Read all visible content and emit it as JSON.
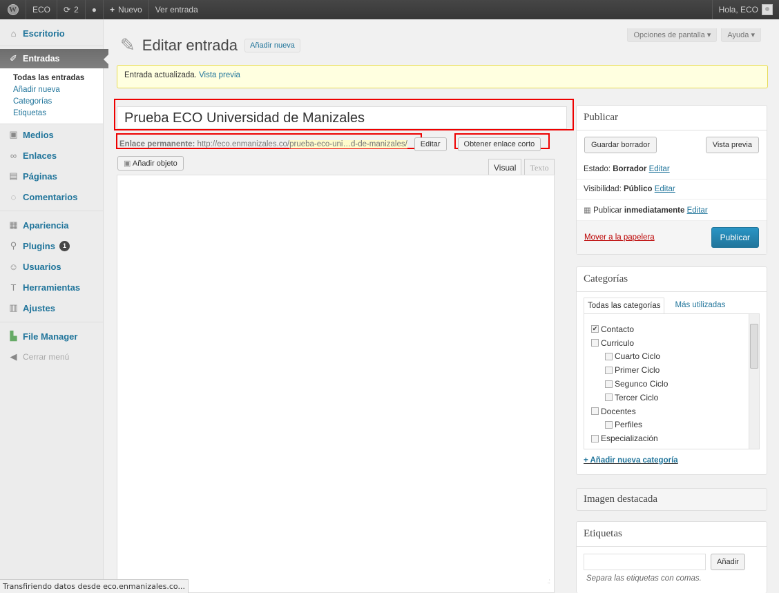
{
  "adminbar": {
    "site_name": "ECO",
    "updates_count": "2",
    "new_label": "Nuevo",
    "view_post": "Ver entrada",
    "greeting": "Hola, ECO"
  },
  "sidebar": {
    "items": [
      {
        "label": "Escritorio",
        "icon": "home-icon"
      },
      {
        "label": "Entradas",
        "icon": "pin-icon"
      },
      {
        "label": "Medios",
        "icon": "media-icon"
      },
      {
        "label": "Enlaces",
        "icon": "link-icon"
      },
      {
        "label": "Páginas",
        "icon": "pages-icon"
      },
      {
        "label": "Comentarios",
        "icon": "comment-icon"
      },
      {
        "label": "Apariencia",
        "icon": "appearance-icon"
      },
      {
        "label": "Plugins",
        "icon": "plugin-icon",
        "badge": "1"
      },
      {
        "label": "Usuarios",
        "icon": "users-icon"
      },
      {
        "label": "Herramientas",
        "icon": "tools-icon"
      },
      {
        "label": "Ajustes",
        "icon": "settings-icon"
      },
      {
        "label": "File Manager",
        "icon": "file-manager-icon"
      }
    ],
    "submenu": [
      "Todas las entradas",
      "Añadir nueva",
      "Categorías",
      "Etiquetas"
    ],
    "collapse_label": "Cerrar menú"
  },
  "header": {
    "screen_options": "Opciones de pantalla",
    "help": "Ayuda",
    "page_title": "Editar entrada",
    "add_new": "Añadir nueva"
  },
  "notice": {
    "text": "Entrada actualizada.",
    "link": "Vista previa"
  },
  "post": {
    "title": "Prueba ECO Universidad de Manizales",
    "permalink_label": "Enlace permanente:",
    "permalink_base": "http://eco.enmanizales.co/",
    "permalink_slug": "prueba-eco-uni…d-de-manizales/",
    "edit_button": "Editar",
    "shortlink_button": "Obtener enlace corto",
    "add_media": "Añadir objeto",
    "tab_visual": "Visual",
    "tab_text": "Texto"
  },
  "publish": {
    "title": "Publicar",
    "save_draft": "Guardar borrador",
    "preview": "Vista previa",
    "status_label": "Estado:",
    "status_value": "Borrador",
    "visibility_label": "Visibilidad:",
    "visibility_value": "Público",
    "schedule_label": "Publicar",
    "schedule_value": "inmediatamente",
    "edit_link": "Editar",
    "trash": "Mover a la papelera",
    "publish_button": "Publicar"
  },
  "categories": {
    "title": "Categorías",
    "tab_all": "Todas las categorías",
    "tab_popular": "Más utilizadas",
    "items": [
      {
        "label": "Contacto",
        "checked": true,
        "level": 0
      },
      {
        "label": "Curriculo",
        "checked": false,
        "level": 0
      },
      {
        "label": "Cuarto Ciclo",
        "checked": false,
        "level": 1
      },
      {
        "label": "Primer Ciclo",
        "checked": false,
        "level": 1
      },
      {
        "label": "Segunco Ciclo",
        "checked": false,
        "level": 1
      },
      {
        "label": "Tercer Ciclo",
        "checked": false,
        "level": 1
      },
      {
        "label": "Docentes",
        "checked": false,
        "level": 0
      },
      {
        "label": "Perfiles",
        "checked": false,
        "level": 1
      },
      {
        "label": "Especialización",
        "checked": false,
        "level": 0
      }
    ],
    "add_new": "+ Añadir nueva categoría"
  },
  "featured": {
    "title": "Imagen destacada"
  },
  "tags": {
    "title": "Etiquetas",
    "add_button": "Añadir",
    "hint": "Separa las etiquetas con comas."
  },
  "statusbar": {
    "text": "Transfiriendo datos desde eco.enmanizales.co..."
  }
}
